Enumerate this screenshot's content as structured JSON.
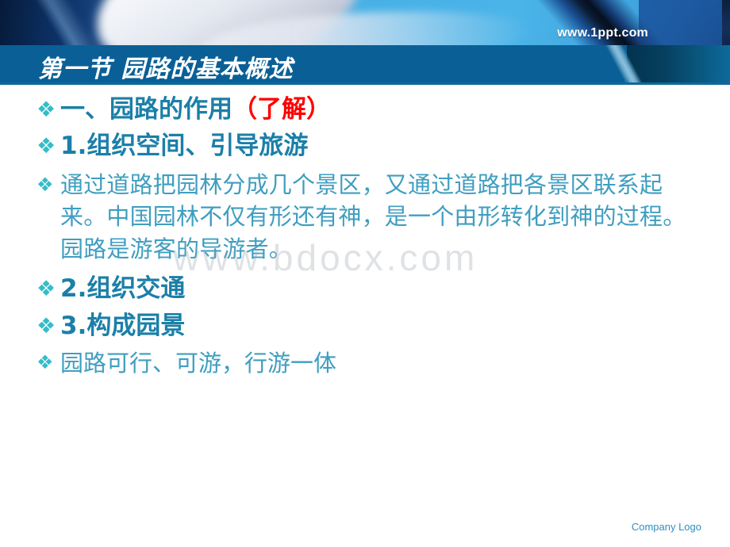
{
  "header": {
    "site_url": "www.1ppt.com",
    "title": "第一节  园路的基本概述"
  },
  "watermark": {
    "text": "www.bdocx.com"
  },
  "footer": {
    "company_logo": "Company Logo"
  },
  "bullets": {
    "glyph": "❖",
    "items": [
      {
        "id": "section-heading",
        "style": "heading",
        "text_main": "一、园路的作用",
        "text_red": "（了解）"
      },
      {
        "id": "point-1",
        "style": "heading",
        "text_main": "1.组织空间、引导旅游",
        "text_red": ""
      },
      {
        "id": "paragraph-1",
        "style": "paragraph",
        "text_main": "通过道路把园林分成几个景区，又通过道路把各景区联系起来。中国园林不仅有形还有神，是一个由形转化到神的过程。园路是游客的导游者。",
        "text_red": ""
      },
      {
        "id": "point-2",
        "style": "heading",
        "text_main": "2.组织交通",
        "text_red": ""
      },
      {
        "id": "point-3",
        "style": "heading",
        "text_main": "3.构成园景",
        "text_red": ""
      },
      {
        "id": "closing-line",
        "style": "plain",
        "text_main": "园路可行、可游，行游一体",
        "text_red": ""
      }
    ]
  },
  "colors": {
    "title_bar": "#0a6096",
    "heading_teal": "#1b7fa8",
    "body_teal": "#3f9ec0",
    "bullet_turquoise": "#35bcc8",
    "accent_red": "#ff0000",
    "footer_blue": "#2f8fc0"
  }
}
